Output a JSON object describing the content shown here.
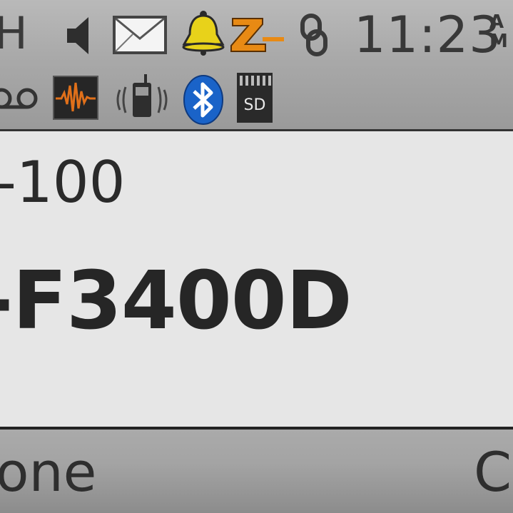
{
  "status_bar": {
    "carrier_text": "H",
    "time": "11:23",
    "am_pm": [
      "A",
      "M"
    ],
    "icons": [
      "speaker-icon",
      "mail-icon",
      "bell-icon",
      "z-app-icon",
      "link-icon",
      "voicemail-icon",
      "waveform-icon",
      "vibrate-phone-icon",
      "bluetooth-icon",
      "sd-card-icon"
    ],
    "sd_label": "SD",
    "colors": {
      "bell": "#e8d21a",
      "z": "#e88a14",
      "bluetooth": "#1a63c8",
      "wave": "#e0701a"
    }
  },
  "main": {
    "line1": "-100",
    "line2": "-F3400D"
  },
  "softkeys": {
    "left": "one",
    "right": "C"
  }
}
